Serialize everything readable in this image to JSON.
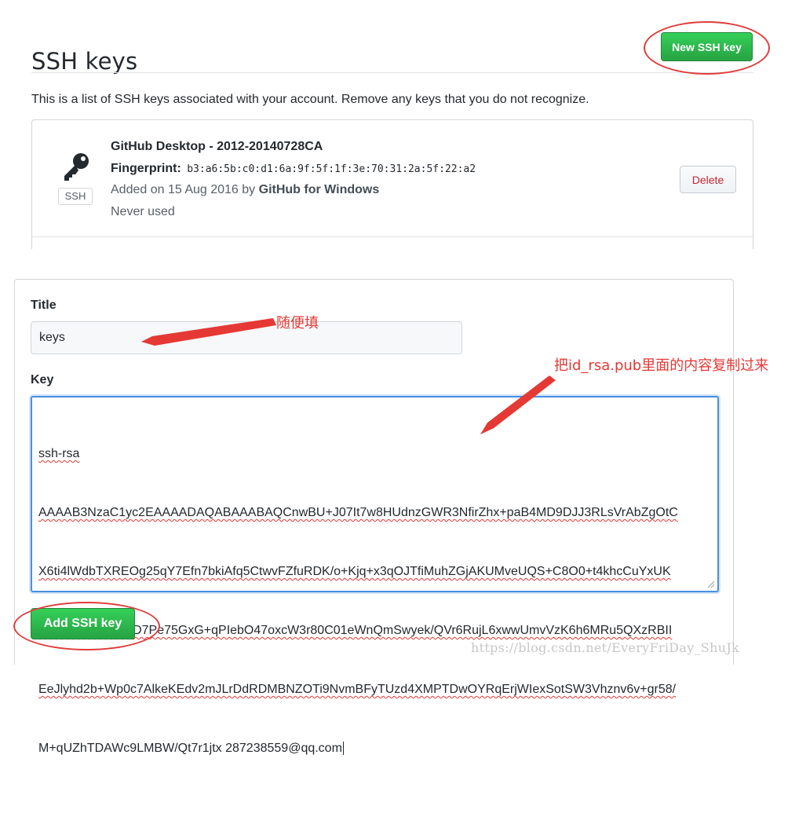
{
  "header": {
    "title": "SSH keys",
    "new_key_label": "New SSH key"
  },
  "intro_text": "This is a list of SSH keys associated with your account. Remove any keys that you do not recognize.",
  "key_entry": {
    "icon": "key-icon",
    "badge": "SSH",
    "name": "GitHub Desktop - 2012-20140728CA",
    "fingerprint_label": "Fingerprint:",
    "fingerprint": "b3:a6:5b:c0:d1:6a:9f:5f:1f:3e:70:31:2a:5f:22:a2",
    "added_prefix": "Added on 15 Aug 2016 by",
    "added_by": "GitHub for Windows",
    "usage": "Never used",
    "delete_label": "Delete"
  },
  "form": {
    "title_label": "Title",
    "title_value": "keys",
    "key_label": "Key",
    "key_lines": [
      "ssh-rsa",
      "AAAAB3NzaC1yc2EAAAADAQABAAABAQCnwBU+J07It7w8HUdnzGWR3NfirZhx+paB4MD9DJJ3RLsVrAbZgOtC",
      "X6ti4lWdbTXREOg25qY7Efn7bkiAfq5CtwvFZfuRDK/o+Kjq+x3qOJTfiMuhZGjAKUMveUQS+C8O0+t4khcCuYxUK",
      "hIjAjib5gEG9y8ZD7Pe75GxG+qPIebO47oxcW3r80C01eWnQmSwyek/QVr6RujL6xwwUmvVzK6h6MRu5QXzRBII",
      "EeJlyhd2b+Wp0c7AlkeKEdv2mJLrDdRDMBNZOTi9NvmBFyTUzd4XMPTDwOYRqErjWIexSotSW3Vhznv6v+gr58/",
      "M+qUZhTDAWc9LMBW/Qt7r1jtx 287238559@qq.com"
    ],
    "add_key_label": "Add SSH key"
  },
  "annotations": {
    "title_note": "随便填",
    "key_note": "把id_rsa.pub里面的内容复制过来",
    "color": "#e53935"
  },
  "watermark": "https://blog.csdn.net/EveryFriDay_ShuJk"
}
